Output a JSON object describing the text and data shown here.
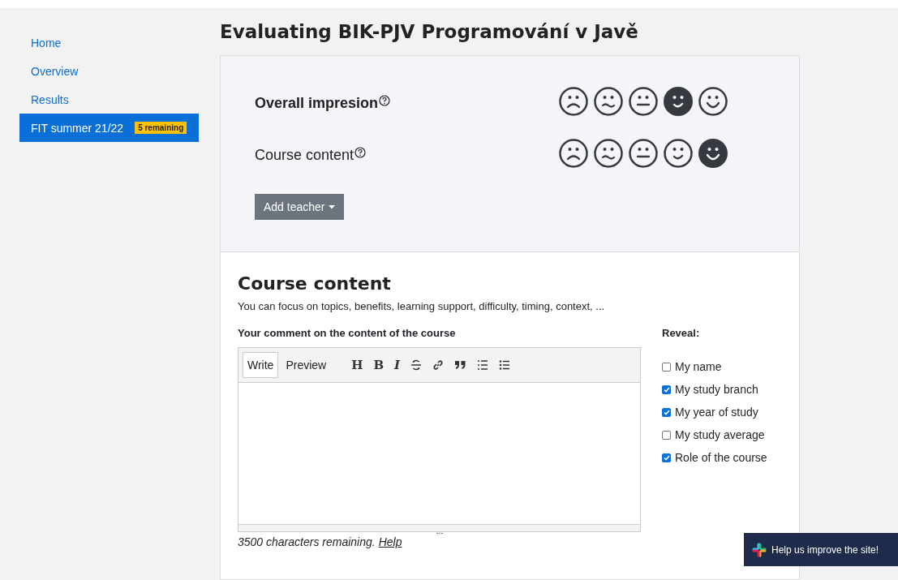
{
  "sidebar": {
    "items": [
      {
        "label": "Home",
        "selected": false
      },
      {
        "label": "Overview",
        "selected": false
      },
      {
        "label": "Results",
        "selected": false
      },
      {
        "label": "FIT summer 21/22",
        "selected": true,
        "badge": "5 remaining"
      }
    ]
  },
  "title": "Evaluating BIK-PJV Programování v Javě",
  "ratings": [
    {
      "label": "Overall impresion",
      "bold": true,
      "faces": [
        {
          "selected": false
        },
        {
          "selected": false
        },
        {
          "selected": false
        },
        {
          "selected": true
        },
        {
          "selected": false
        }
      ]
    },
    {
      "label": "Course content",
      "bold": false,
      "faces": [
        {
          "selected": false
        },
        {
          "selected": false
        },
        {
          "selected": false
        },
        {
          "selected": false
        },
        {
          "selected": true
        }
      ]
    }
  ],
  "add_teacher_button": "Add teacher",
  "section": {
    "heading": "Course content",
    "description": "You can focus on topics, benefits, learning support, difficulty, timing, context, ...",
    "comment_label": "Your comment on the content of the course",
    "editor": {
      "tabs": [
        {
          "label": "Write",
          "selected": true
        },
        {
          "label": "Preview",
          "selected": false
        }
      ],
      "tools": [
        {
          "kind": "char",
          "label": "H"
        },
        {
          "kind": "char",
          "label": "B"
        },
        {
          "kind": "char",
          "label": "I"
        },
        {
          "kind": "strike"
        },
        {
          "kind": "link"
        },
        {
          "kind": "quote"
        },
        {
          "kind": "ordered"
        },
        {
          "kind": "bullets"
        }
      ]
    },
    "remaining": "3500 characters remaining.",
    "help_link": "Help",
    "reveal": {
      "label": "Reveal:",
      "options": [
        {
          "label": "My name",
          "checked": false
        },
        {
          "label": "My study branch",
          "checked": true
        },
        {
          "label": "My year of study",
          "checked": true
        },
        {
          "label": "My study average",
          "checked": false
        },
        {
          "label": "Role of the course",
          "checked": true
        }
      ]
    }
  },
  "feedback_button": "Help us improve the site!"
}
